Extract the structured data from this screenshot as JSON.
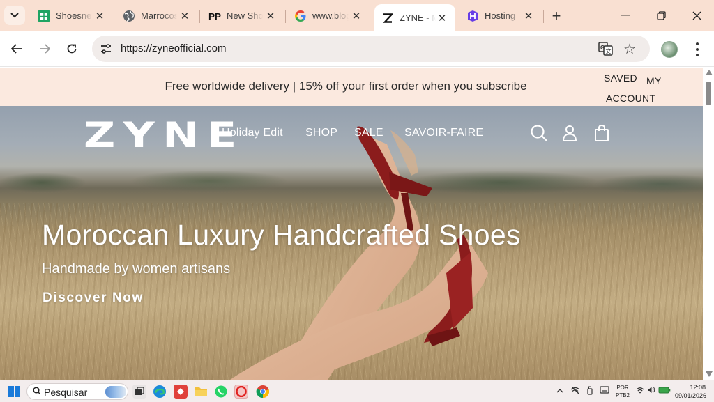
{
  "browser": {
    "tabs": [
      {
        "title": "Shoesnew",
        "icon": "sheets-icon",
        "active": false
      },
      {
        "title": "Marrocos",
        "icon": "globe-icon",
        "active": false
      },
      {
        "title": "New Shoes",
        "icon": "pp-icon",
        "active": false
      },
      {
        "title": "www.blogger.com",
        "icon": "google-icon",
        "active": false
      },
      {
        "title": "ZYNE - M",
        "icon": "zyne-icon",
        "active": true
      },
      {
        "title": "Hosting",
        "icon": "hosting-icon",
        "active": false
      }
    ],
    "tab_close_glyph": "✕",
    "new_tab_glyph": "+",
    "url": "https://zyneofficial.com"
  },
  "site": {
    "announcement": "Free worldwide delivery | 15% off your first order when you subscribe",
    "saved_label": "SAVED",
    "account_line1": "MY",
    "account_line2": "ACCOUNT",
    "logo": "ZYNE",
    "nav": [
      "Holiday Edit",
      "SHOP",
      "SALE",
      "SAVOIR-FAIRE"
    ],
    "hero": {
      "headline": "Moroccan Luxury Handcrafted Shoes",
      "subline": "Handmade by women artisans",
      "cta": "Discover Now"
    }
  },
  "taskbar": {
    "search_placeholder": "Pesquisar",
    "language_line1": "POR",
    "language_line2": "PTB2",
    "time": "12:08",
    "date": "09/01/2026"
  },
  "colors": {
    "tabstrip_bg": "#f9e0d2",
    "announcement_bg": "#fbe9df",
    "shoe_red": "#8b1c1c"
  }
}
